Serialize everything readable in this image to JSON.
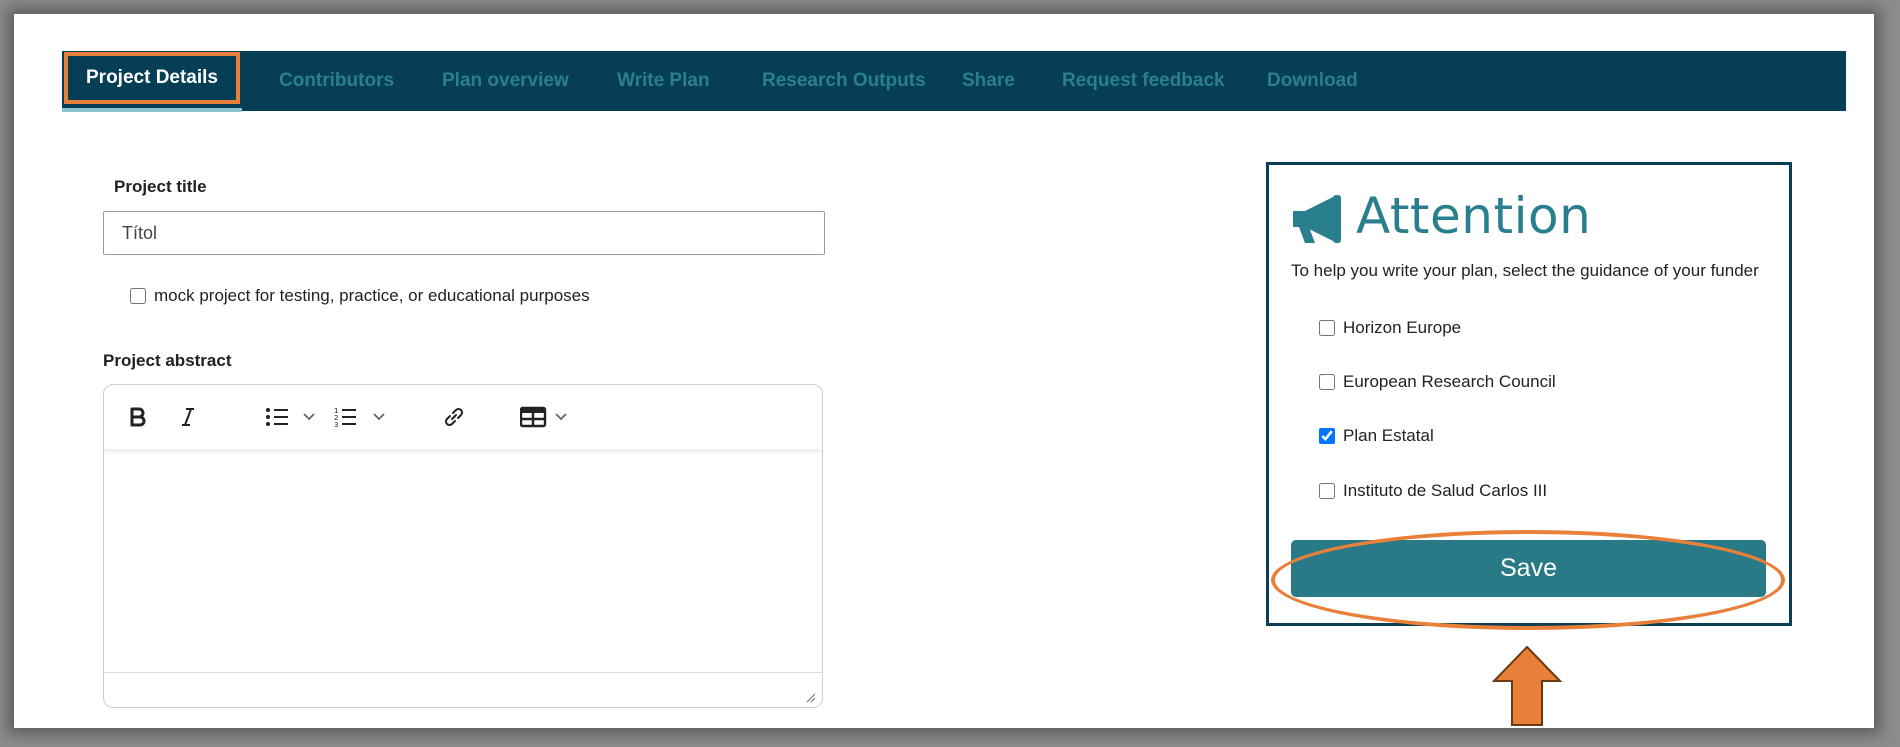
{
  "tabs": [
    {
      "label": "Project Details",
      "active": true
    },
    {
      "label": "Contributors"
    },
    {
      "label": "Plan overview"
    },
    {
      "label": "Write Plan"
    },
    {
      "label": "Research Outputs"
    },
    {
      "label": "Share"
    },
    {
      "label": "Request feedback"
    },
    {
      "label": "Download"
    }
  ],
  "form": {
    "title_label": "Project title",
    "title_value": "Títol",
    "mock_label": "mock project for testing, practice, or educational purposes",
    "mock_checked": false,
    "abstract_label": "Project abstract"
  },
  "editor": {
    "toolbar": [
      "bold-icon",
      "italic-icon",
      "bulleted-list-icon",
      "numbered-list-icon",
      "link-icon",
      "table-icon"
    ]
  },
  "attention": {
    "title": "Attention",
    "subtitle": "To help you write your plan, select the guidance of your funder",
    "options": [
      {
        "label": "Horizon Europe",
        "checked": false
      },
      {
        "label": "European Research Council",
        "checked": false
      },
      {
        "label": "Plan Estatal",
        "checked": true
      },
      {
        "label": "Instituto de Salud Carlos III",
        "checked": false
      }
    ],
    "save_label": "Save"
  },
  "colors": {
    "navbar": "#063f55",
    "tab_inactive": "#2a7f8f",
    "highlight": "#e8803a",
    "save_button": "#2a7986",
    "panel_border": "#0b3f55"
  }
}
